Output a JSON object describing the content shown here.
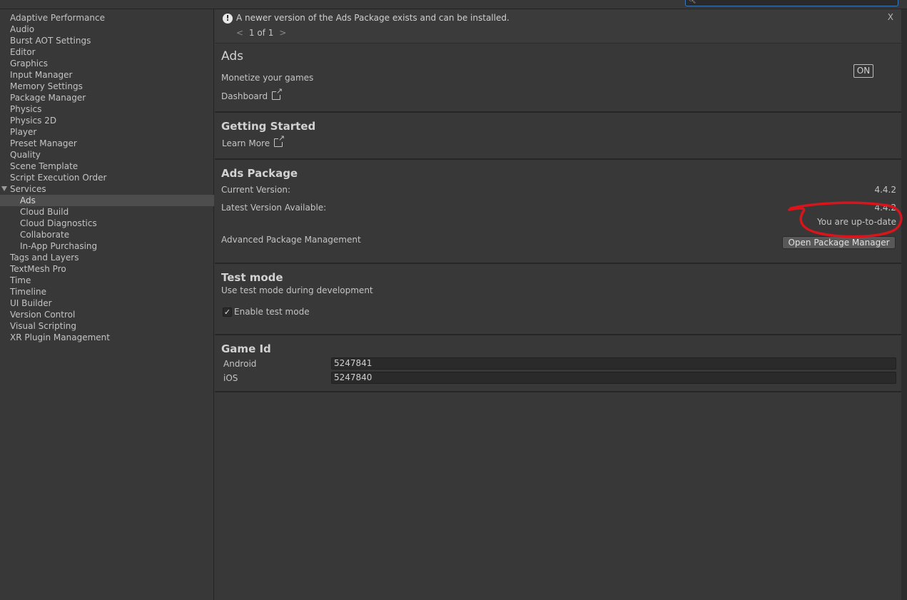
{
  "sidebar": {
    "items": [
      {
        "label": "Adaptive Performance"
      },
      {
        "label": "Audio"
      },
      {
        "label": "Burst AOT Settings"
      },
      {
        "label": "Editor"
      },
      {
        "label": "Graphics"
      },
      {
        "label": "Input Manager"
      },
      {
        "label": "Memory Settings"
      },
      {
        "label": "Package Manager"
      },
      {
        "label": "Physics"
      },
      {
        "label": "Physics 2D"
      },
      {
        "label": "Player"
      },
      {
        "label": "Preset Manager"
      },
      {
        "label": "Quality"
      },
      {
        "label": "Scene Template"
      },
      {
        "label": "Script Execution Order"
      },
      {
        "label": "Services"
      },
      {
        "label": "Ads"
      },
      {
        "label": "Cloud Build"
      },
      {
        "label": "Cloud Diagnostics"
      },
      {
        "label": "Collaborate"
      },
      {
        "label": "In-App Purchasing"
      },
      {
        "label": "Tags and Layers"
      },
      {
        "label": "TextMesh Pro"
      },
      {
        "label": "Time"
      },
      {
        "label": "Timeline"
      },
      {
        "label": "UI Builder"
      },
      {
        "label": "Version Control"
      },
      {
        "label": "Visual Scripting"
      },
      {
        "label": "XR Plugin Management"
      }
    ],
    "selected": "Ads"
  },
  "notice": {
    "icon": "exclamation-icon",
    "message": "A newer version of the Ads Package exists and can be installed.",
    "close": "X",
    "prev": "<",
    "page": "1 of 1",
    "next": ">"
  },
  "ads": {
    "title": "Ads",
    "subtitle": "Monetize your games",
    "dashboard_link": "Dashboard",
    "toggle": "ON"
  },
  "getting_started": {
    "title": "Getting Started",
    "learn_more": "Learn More"
  },
  "package": {
    "title": "Ads Package",
    "current_label": "Current Version:",
    "current_value": "4.4.2",
    "latest_label": "Latest Version Available:",
    "latest_value": "4.4.2",
    "status": "You are up-to-date",
    "advanced_label": "Advanced Package Management",
    "open_pm_button": "Open Package Manager"
  },
  "test_mode": {
    "title": "Test mode",
    "description": "Use test mode during development",
    "checkbox_label": "Enable test mode",
    "checked": true
  },
  "game_id": {
    "title": "Game Id",
    "rows": [
      {
        "label": "Android",
        "value": "5247841"
      },
      {
        "label": "iOS",
        "value": "5247840"
      }
    ]
  },
  "colors": {
    "annotation": "#d9141b",
    "background": "#383838",
    "selected_row": "#4d4d4d"
  }
}
